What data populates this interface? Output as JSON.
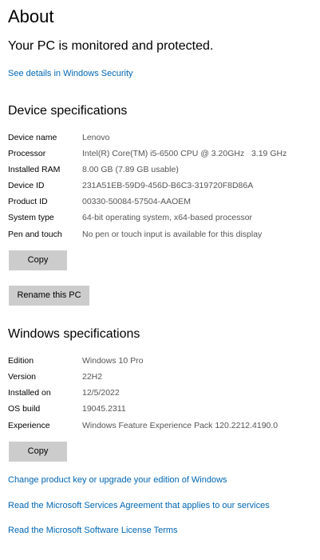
{
  "header": {
    "title": "About",
    "protection_status": "Your PC is monitored and protected.",
    "security_link": "See details in Windows Security"
  },
  "device_specs": {
    "title": "Device specifications",
    "rows": [
      {
        "label": "Device name",
        "value": "Lenovo"
      },
      {
        "label": "Processor",
        "value": "Intel(R) Core(TM) i5-6500 CPU @ 3.20GHz   3.19 GHz"
      },
      {
        "label": "Installed RAM",
        "value": "8.00 GB (7.89 GB usable)"
      },
      {
        "label": "Device ID",
        "value": "231A51EB-59D9-456D-B6C3-319720F8D86A"
      },
      {
        "label": "Product ID",
        "value": "00330-50084-57504-AAOEM"
      },
      {
        "label": "System type",
        "value": "64-bit operating system, x64-based processor"
      },
      {
        "label": "Pen and touch",
        "value": "No pen or touch input is available for this display"
      }
    ],
    "copy_label": "Copy",
    "rename_label": "Rename this PC"
  },
  "windows_specs": {
    "title": "Windows specifications",
    "rows": [
      {
        "label": "Edition",
        "value": "Windows 10 Pro"
      },
      {
        "label": "Version",
        "value": "22H2"
      },
      {
        "label": "Installed on",
        "value": "12/5/2022"
      },
      {
        "label": "OS build",
        "value": "19045.2311"
      },
      {
        "label": "Experience",
        "value": "Windows Feature Experience Pack 120.2212.4190.0"
      }
    ],
    "copy_label": "Copy"
  },
  "links": {
    "product_key": "Change product key or upgrade your edition of Windows",
    "services_agreement": "Read the Microsoft Services Agreement that applies to our services",
    "license_terms": "Read the Microsoft Software License Terms"
  },
  "colors": {
    "link": "#0066b4",
    "value_text": "#555555",
    "button_bg": "#cccccc"
  }
}
